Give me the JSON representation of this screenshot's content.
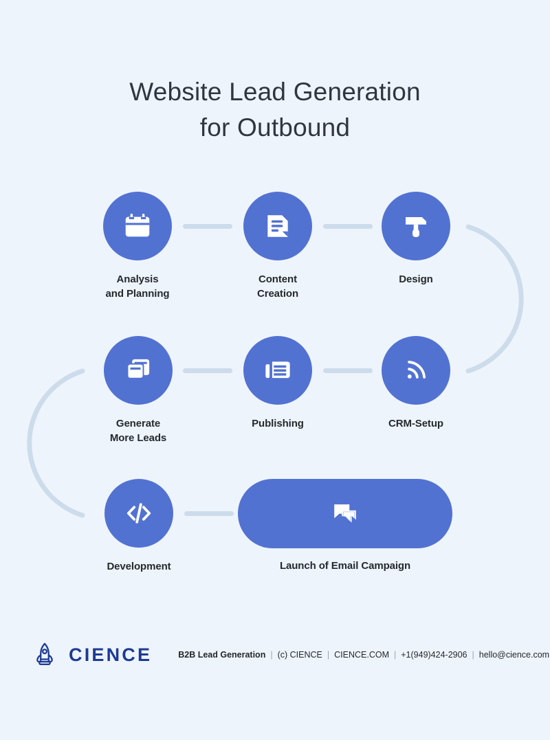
{
  "background_color": "#eef4fc",
  "accent_color": "#5272d2",
  "connector_color": "#ccdceb",
  "label_color": "#24292e",
  "brand_color": "#1d3a94",
  "title": {
    "line1": "Website Lead Generation",
    "line2": "for Outbound"
  },
  "steps": [
    {
      "id": "analysis-and-planning",
      "label_line1": "Analysis",
      "label_line2": "and Planning",
      "icon": "calendar-icon"
    },
    {
      "id": "content-creation",
      "label_line1": "Content",
      "label_line2": "Creation",
      "icon": "document-icon"
    },
    {
      "id": "design",
      "label_line1": "Design",
      "label_line2": "",
      "icon": "paint-brush-icon"
    },
    {
      "id": "generate-more-leads",
      "label_line1": "Generate",
      "label_line2": "More Leads",
      "icon": "stacked-cards-icon"
    },
    {
      "id": "publishing",
      "label_line1": "Publishing",
      "label_line2": "",
      "icon": "newspaper-icon"
    },
    {
      "id": "crm-setup",
      "label_line1": "CRM-Setup",
      "label_line2": "",
      "icon": "rss-signal-icon"
    },
    {
      "id": "development",
      "label_line1": "Development",
      "label_line2": "",
      "icon": "code-brackets-icon"
    }
  ],
  "final_step": {
    "id": "launch-of-email-campaign",
    "label": "Launch of Email Campaign",
    "icon": "chat-bubbles-icon"
  },
  "footer": {
    "logo_icon": "rocket-icon",
    "brand_name": "CIENCE",
    "tagline": "B2B Lead Generation",
    "copyright": "(c) CIENCE",
    "website": "CIENCE.COM",
    "phone": "+1(949)424-2906",
    "email": "hello@cience.com",
    "separator": "|"
  }
}
